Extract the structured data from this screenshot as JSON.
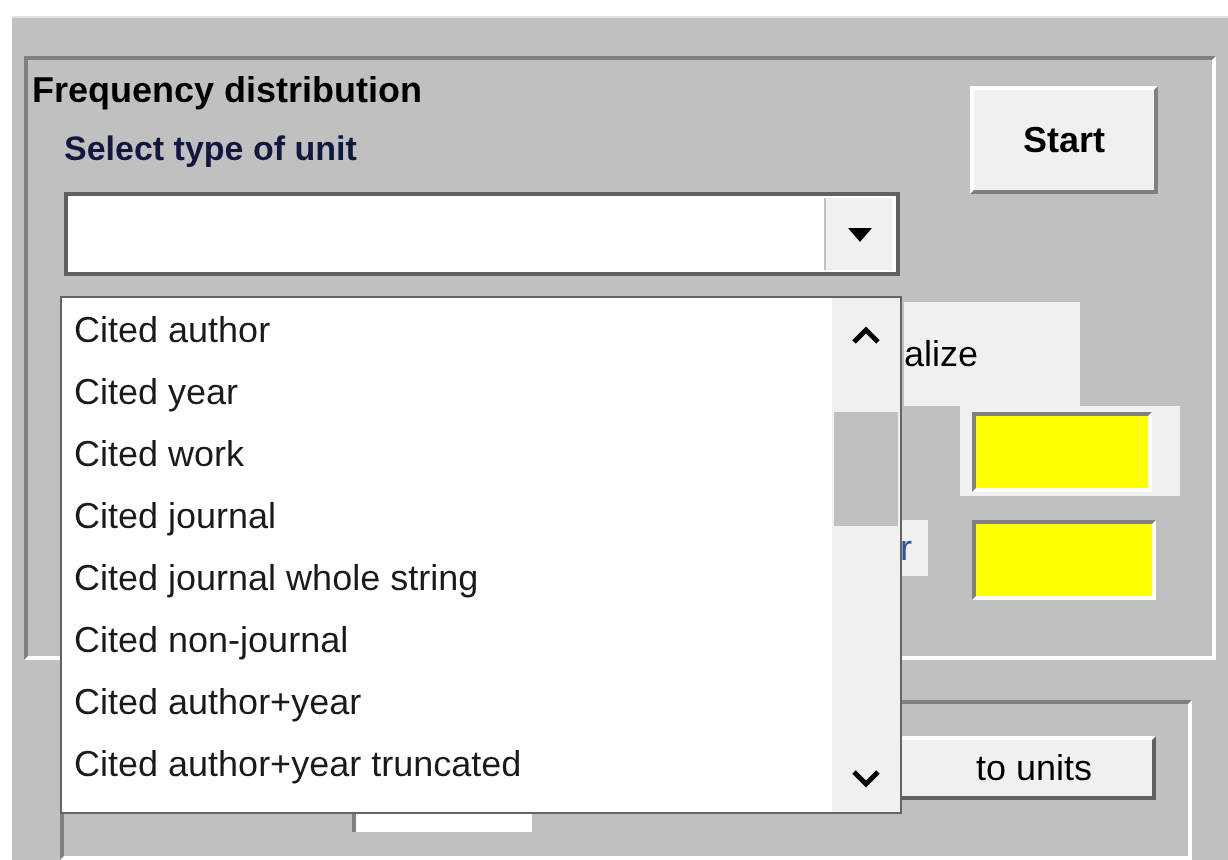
{
  "group": {
    "title": "Frequency distribution",
    "label": "Select type of unit",
    "combo": {
      "expanded": true
    },
    "start_button": "Start"
  },
  "dropdown": {
    "items": [
      {
        "label": "Cited author",
        "selected": false
      },
      {
        "label": "Cited year",
        "selected": false
      },
      {
        "label": "Cited work",
        "selected": false
      },
      {
        "label": "Cited journal",
        "selected": false
      },
      {
        "label": "Cited journal whole string",
        "selected": false
      },
      {
        "label": "Cited non-journal",
        "selected": false
      },
      {
        "label": "Cited author+year",
        "selected": false
      },
      {
        "label": "Cited author+year truncated",
        "selected": false
      }
    ]
  },
  "behind": {
    "tab": "alize",
    "field_label": "r",
    "units_button": "to units"
  }
}
